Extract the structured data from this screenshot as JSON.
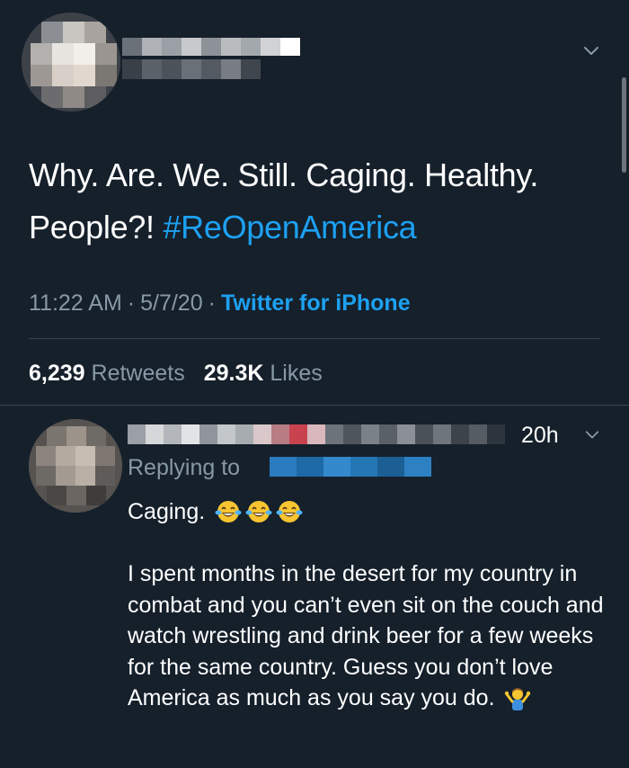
{
  "tweet": {
    "text": "Why. Are. We. Still. Caging. Healthy. People?!",
    "hashtag": "#ReOpenAmerica",
    "time": "11:22 AM",
    "separator": "·",
    "date": "5/7/20",
    "source": "Twitter for iPhone",
    "retweets_count": "6,239",
    "retweets_label": "Retweets",
    "likes_count": "29.3K",
    "likes_label": "Likes"
  },
  "reply": {
    "time": "20h",
    "replying_label": "Replying to",
    "line1": "Caging.",
    "line1_emojis": [
      "face-with-tears-of-joy-icon",
      "face-with-tears-of-joy-icon",
      "face-with-tears-of-joy-icon"
    ],
    "body": "I spent months in the desert for my country in combat and you can’t even sit on the couch and watch wrestling and drink beer for a few weeks for the same country. Guess you don’t love America as much as you say you do.",
    "trailing_emoji": "person-shrugging-icon"
  },
  "colors": {
    "background": "#15202b",
    "accent": "#1da1f2",
    "secondary_text": "#8899a6",
    "divider": "#38444d"
  },
  "icons": {
    "menu": "chevron-down-icon"
  }
}
